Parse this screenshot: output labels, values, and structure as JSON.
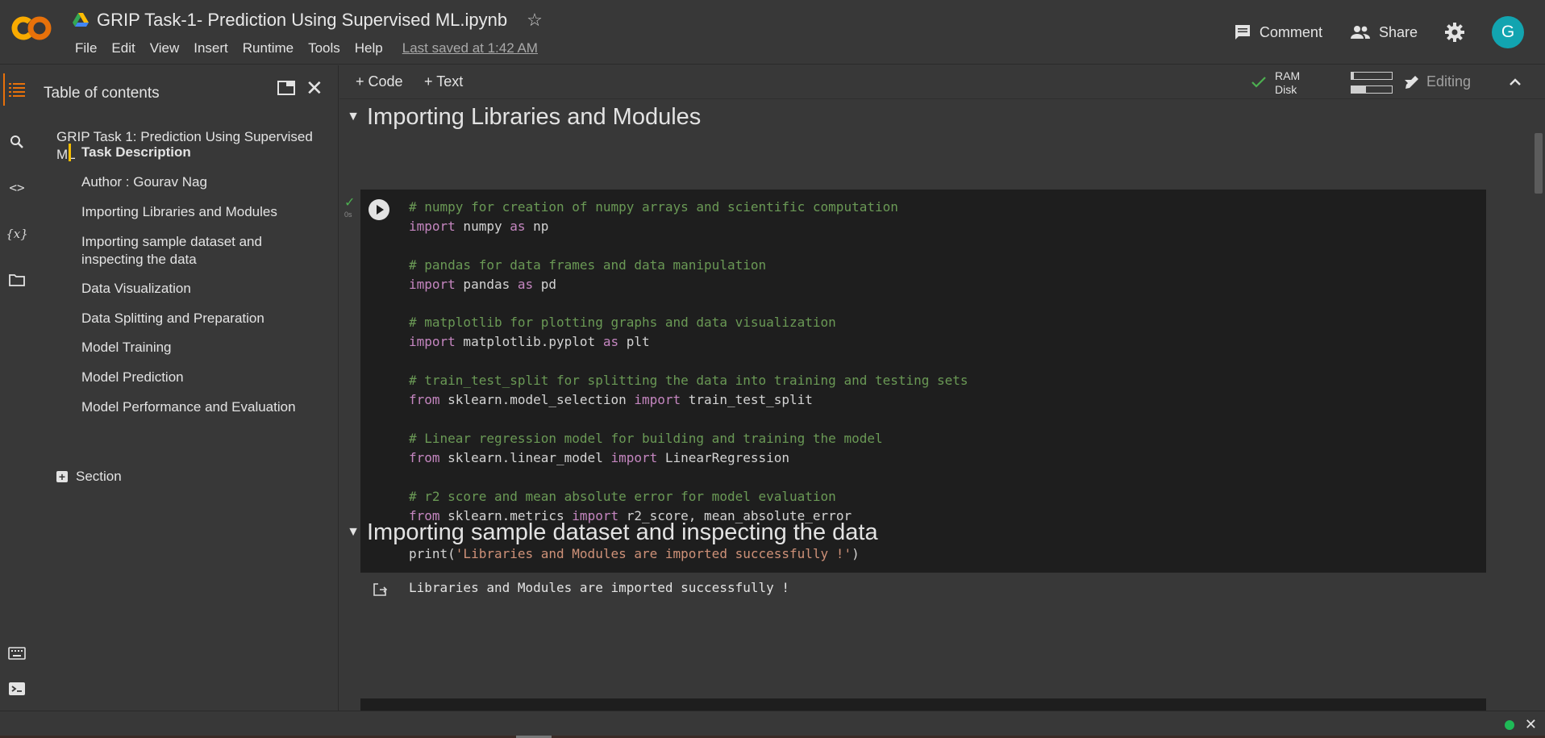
{
  "header": {
    "notebook_title": "GRIP Task-1- Prediction Using Supervised ML.ipynb",
    "menu": [
      "File",
      "Edit",
      "View",
      "Insert",
      "Runtime",
      "Tools",
      "Help"
    ],
    "last_saved": "Last saved at 1:42 AM",
    "comment_label": "Comment",
    "share_label": "Share",
    "avatar_letter": "G",
    "brand_color": "#f9ab00"
  },
  "toc": {
    "title": "Table of contents",
    "top_item": "GRIP Task 1: Prediction Using Supervised ML",
    "items": [
      "Task Description",
      "Author : Gourav Nag",
      "Importing Libraries and Modules",
      "Importing sample dataset and inspecting the data",
      "Data Visualization",
      "Data Splitting and Preparation",
      "Model Training",
      "Model Prediction",
      "Model Performance and Evaluation"
    ],
    "add_section": "Section"
  },
  "toolbar": {
    "code_label": "+ Code",
    "text_label": "+ Text",
    "ram_label": "RAM",
    "disk_label": "Disk",
    "ram_usage": 0.05,
    "disk_usage": 0.35,
    "editing_label": "Editing"
  },
  "notebook": {
    "heading1": "Importing Libraries and Modules",
    "exec_time": "0s",
    "output": "Libraries and Modules are imported successfully !",
    "heading2": "Importing sample dataset and inspecting the data"
  }
}
